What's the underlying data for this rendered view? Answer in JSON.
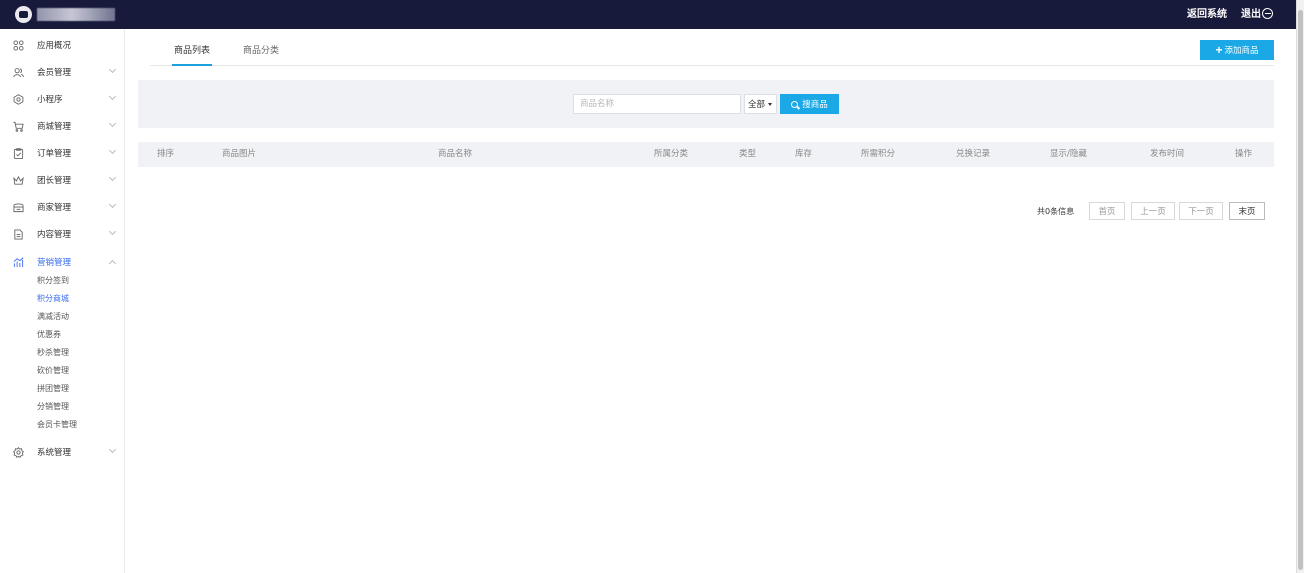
{
  "topbar": {
    "app_name": "",
    "return_label": "返回系统",
    "logout_label": "退出"
  },
  "sidebar": {
    "items": [
      {
        "label": "应用概况",
        "icon": "grid-icon"
      },
      {
        "label": "会员管理",
        "icon": "users-icon"
      },
      {
        "label": "小程序",
        "icon": "hexagon-icon"
      },
      {
        "label": "商城管理",
        "icon": "cart-icon"
      },
      {
        "label": "订单管理",
        "icon": "clipboard-icon"
      },
      {
        "label": "团长管理",
        "icon": "crown-icon"
      },
      {
        "label": "商家管理",
        "icon": "store-icon"
      },
      {
        "label": "内容管理",
        "icon": "document-icon"
      },
      {
        "label": "营销管理",
        "icon": "chart-icon"
      },
      {
        "label": "系统管理",
        "icon": "gear-icon"
      }
    ],
    "marketing_sub": [
      "积分签到",
      "积分商城",
      "满减活动",
      "优惠券",
      "秒杀管理",
      "砍价管理",
      "拼团管理",
      "分销管理",
      "会员卡管理"
    ],
    "active_sub_index": 1
  },
  "tabs": [
    "商品列表",
    "商品分类"
  ],
  "add_button": "添加商品",
  "search": {
    "placeholder": "商品名称",
    "value": "",
    "select_value": "全部",
    "button": "搜商品"
  },
  "table": {
    "columns": [
      "排序",
      "商品图片",
      "商品名称",
      "所属分类",
      "类型",
      "库存",
      "所需积分",
      "兑换记录",
      "显示/隐藏",
      "发布时间",
      "操作"
    ],
    "rows": []
  },
  "pager": {
    "info": "共0条信息",
    "first": "首页",
    "prev": "上一页",
    "next": "下一页",
    "last": "末页"
  },
  "colors": {
    "topbar_bg": "#181a3b",
    "accent": "#1aa9e6",
    "active_menu": "#3a6cf0"
  }
}
